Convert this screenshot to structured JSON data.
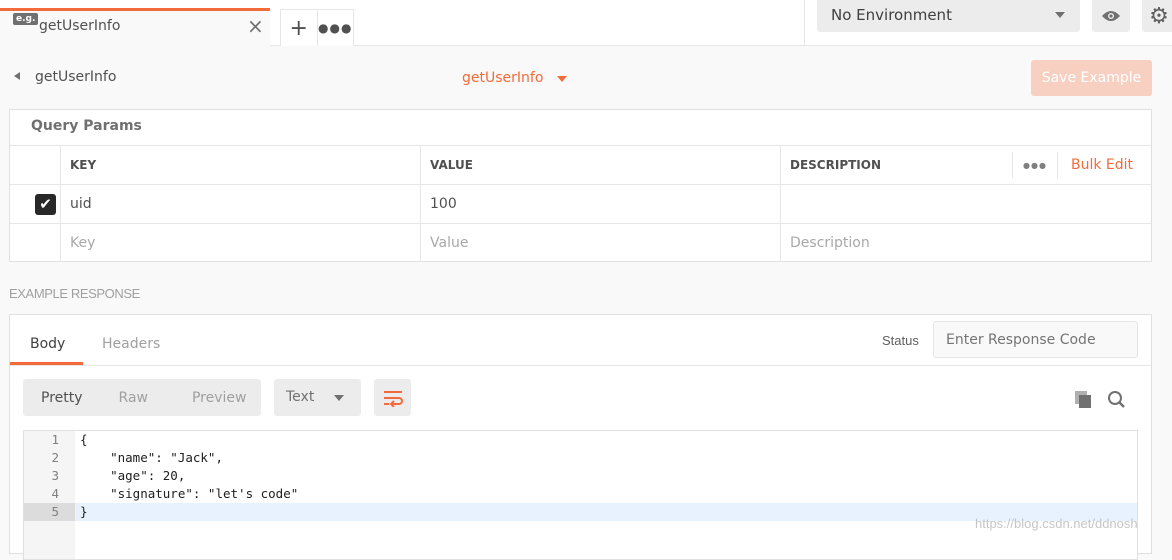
{
  "tab": {
    "badge": "e.g.",
    "title": "getUserInfo"
  },
  "env": {
    "selected": "No Environment"
  },
  "header": {
    "back_label": "getUserInfo",
    "example_name": "getUserInfo",
    "save_label": "Save Example"
  },
  "params": {
    "title": "Query Params",
    "columns": [
      "KEY",
      "VALUE",
      "DESCRIPTION"
    ],
    "bulk_edit": "Bulk Edit",
    "rows": [
      {
        "checked": true,
        "key": "uid",
        "value": "100",
        "description": ""
      }
    ],
    "placeholders": {
      "key": "Key",
      "value": "Value",
      "description": "Description"
    }
  },
  "response": {
    "section_label": "EXAMPLE RESPONSE",
    "tabs": [
      "Body",
      "Headers"
    ],
    "active_tab": "Body",
    "status_label": "Status",
    "status_placeholder": "Enter Response Code",
    "modes": [
      "Pretty",
      "Raw",
      "Preview"
    ],
    "active_mode": "Pretty",
    "format": "Text",
    "lines": [
      "{",
      "    \"name\": \"Jack\",",
      "    \"age\": 20,",
      "    \"signature\": \"let's code\"",
      "}"
    ],
    "line_numbers": [
      "1",
      "2",
      "3",
      "4",
      "5"
    ]
  },
  "watermark": "https://blog.csdn.net/ddnosh",
  "colors": {
    "accent": "#f26b3a",
    "save_disabled": "#f8d0c2"
  }
}
